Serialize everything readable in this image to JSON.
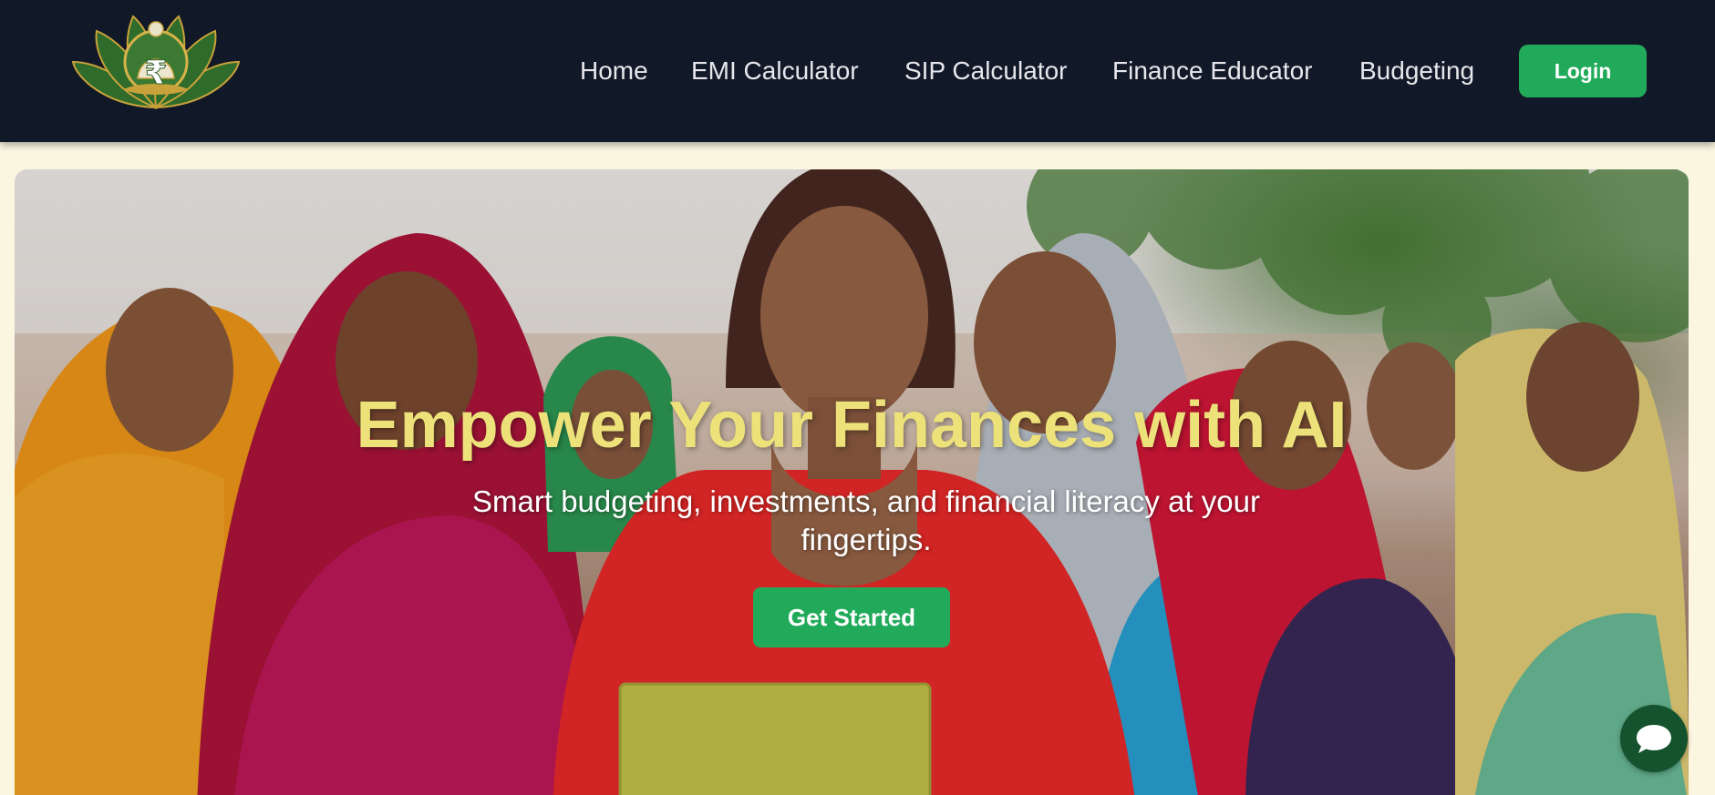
{
  "brand": {
    "logo_icon": "rupee-lotus-logo",
    "logo_symbol": "₹"
  },
  "nav": {
    "items": [
      {
        "label": "Home"
      },
      {
        "label": "EMI Calculator"
      },
      {
        "label": "SIP Calculator"
      },
      {
        "label": "Finance Educator"
      },
      {
        "label": "Budgeting"
      }
    ],
    "login_label": "Login"
  },
  "hero": {
    "title": "Empower Your Finances with AI",
    "subtitle": "Smart budgeting, investments, and financial literacy at your fingertips.",
    "cta_label": "Get Started",
    "background_image": "women-group-photo"
  },
  "chat": {
    "icon": "chat-bubble-icon"
  },
  "colors": {
    "navbar_bg": "#111827",
    "accent_green": "#22aa5b",
    "title_yellow": "#ede27a",
    "page_bg": "#fbf6e0",
    "chat_bg": "#14532d"
  }
}
